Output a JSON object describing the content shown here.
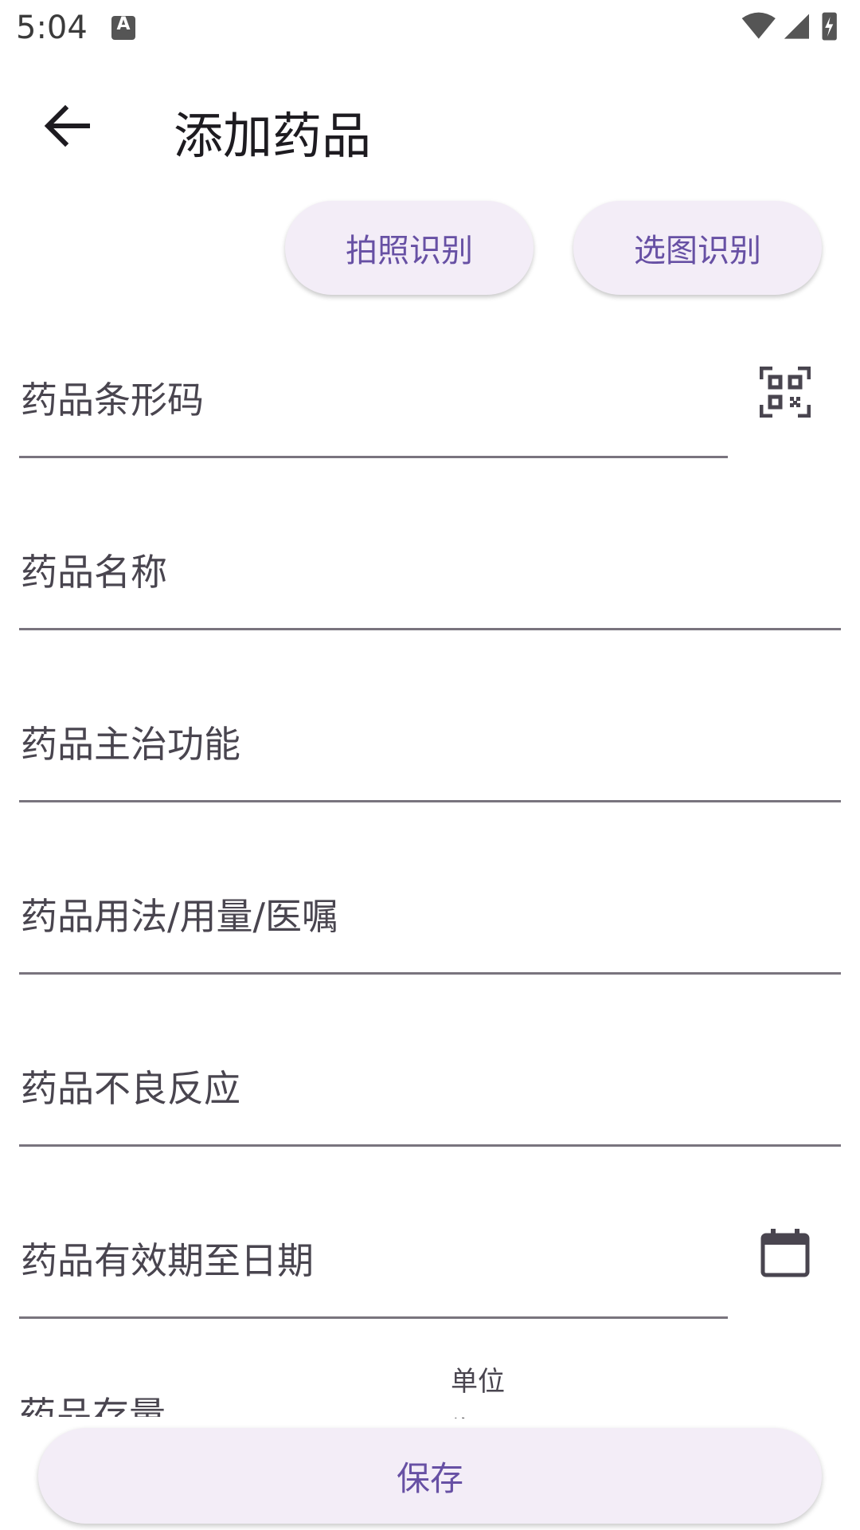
{
  "status": {
    "time": "5:04",
    "notif_letter": "A"
  },
  "appbar": {
    "title": "添加药品"
  },
  "actions": {
    "photo": "拍照识别",
    "gallery": "选图识别"
  },
  "fields": {
    "barcode": "药品条形码",
    "name": "药品名称",
    "indication": "药品主治功能",
    "usage": "药品用法/用量/医嘱",
    "adverse": "药品不良反应",
    "expiry": "药品有效期至日期",
    "stock": "药品存量",
    "unit_label": "单位",
    "unit_value": "瓶"
  },
  "footer": {
    "save": "保存"
  },
  "colors": {
    "accent": "#6750a4",
    "pill_bg": "#f3edf7",
    "line": "#79747e"
  }
}
